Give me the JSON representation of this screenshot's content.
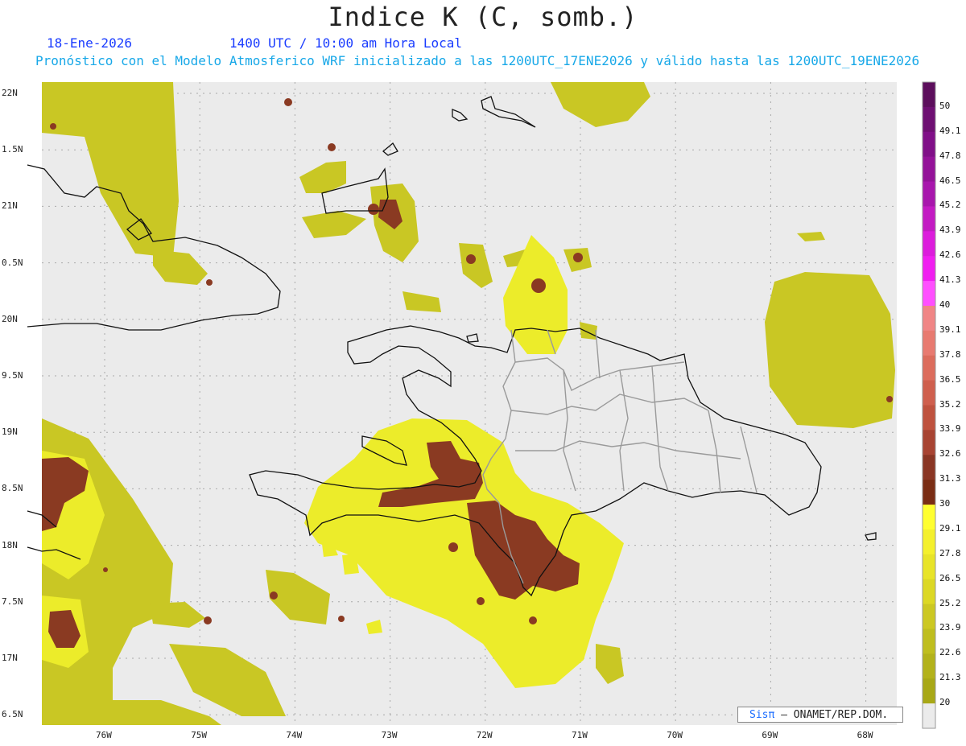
{
  "title": "Indice K (C, somb.)",
  "header": {
    "date": "18-Ene-2026",
    "time": "1400 UTC / 10:00 am Hora Local",
    "subtitle": "Pronóstico con el Modelo Atmosferico WRF inicializado a las 1200UTC_17ENE2026 y válido hasta las  1200UTC_19ENE2026"
  },
  "axes": {
    "y_ticks": [
      "22N",
      "1.5N",
      "21N",
      "0.5N",
      "20N",
      "9.5N",
      "19N",
      "8.5N",
      "18N",
      "7.5N",
      "17N",
      "6.5N"
    ],
    "x_ticks": [
      "76W",
      "75W",
      "74W",
      "73W",
      "72W",
      "71W",
      "70W",
      "69W",
      "68W"
    ]
  },
  "colorbar": {
    "labels": [
      "50",
      "49.1",
      "47.8",
      "46.5",
      "45.2",
      "43.9",
      "42.6",
      "41.3",
      "40",
      "39.1",
      "37.8",
      "36.5",
      "35.2",
      "33.9",
      "32.6",
      "31.3",
      "30",
      "29.1",
      "27.8",
      "26.5",
      "25.2",
      "23.9",
      "22.6",
      "21.3",
      "20"
    ],
    "colors": [
      "#5c0e5c",
      "#6e0f72",
      "#800f88",
      "#941299",
      "#a816ad",
      "#c31ac3",
      "#dc1cdc",
      "#f01ef0",
      "#ff4fff",
      "#f08585",
      "#e87a70",
      "#dc6c5c",
      "#cf5f4d",
      "#bf523e",
      "#a84432",
      "#8a3624",
      "#7a2d14",
      "#ffff30",
      "#f4f02c",
      "#e8e428",
      "#dcd824",
      "#ccc822",
      "#bfbe1e",
      "#b3b21a",
      "#a8a816"
    ]
  },
  "credit": {
    "brand": "Sisπ",
    "text": "– ONAMET/REP.DOM."
  },
  "legend_colors": {
    "low": "#c9c724",
    "mid": "#ecec2a",
    "high": "#f8f82e",
    "storm": "#8a3a22",
    "background": "#ebebeb"
  }
}
